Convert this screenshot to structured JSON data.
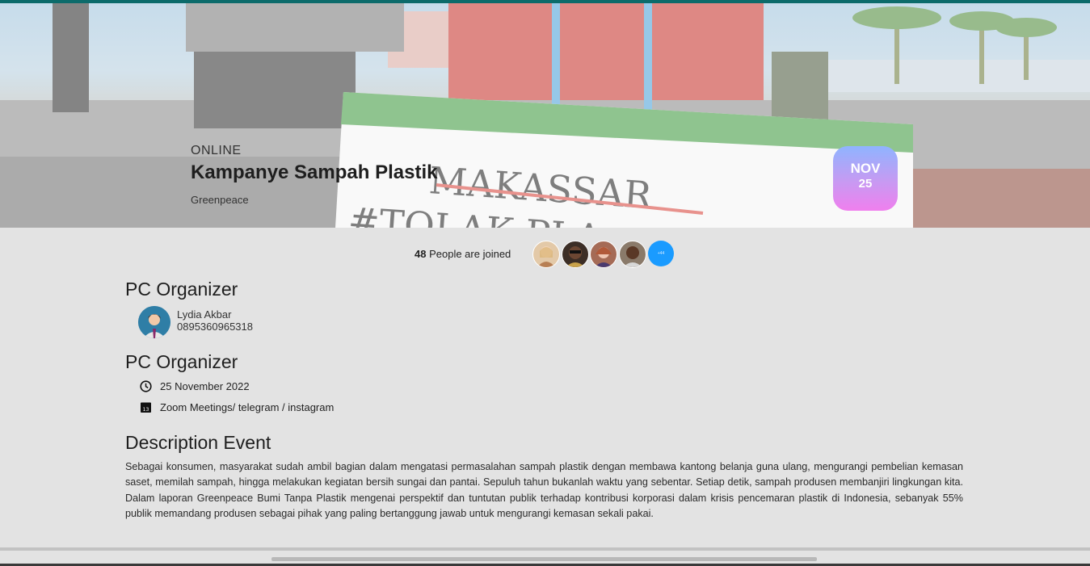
{
  "hero": {
    "status": "ONLINE",
    "title": "Kampanye Sampah Plastik",
    "organization": "Greenpeace",
    "date_month": "NOV",
    "date_day": "25",
    "poster_line1": "MAKASSAR",
    "poster_line2": "#TOLAK PLA"
  },
  "joined": {
    "count": "48",
    "label": "People are joined",
    "more_label": "+44"
  },
  "organizer": {
    "heading": "PC Organizer",
    "name": "Lydia Akbar",
    "phone": "0895360965318"
  },
  "details": {
    "heading": "PC Organizer",
    "date": "25 November 2022",
    "calendar_day": "13",
    "location": "Zoom Meetings/ telegram / instagram"
  },
  "description": {
    "heading": "Description Event",
    "body": "Sebagai konsumen, masyarakat sudah ambil bagian dalam mengatasi permasalahan sampah plastik dengan membawa kantong belanja guna ulang, mengurangi pembelian kemasan saset, memilah sampah, hingga melakukan kegiatan bersih sungai dan pantai. Sepuluh tahun bukanlah waktu yang sebentar. Setiap detik, sampah produsen membanjiri lingkungan kita. Dalam laporan Greenpeace Bumi Tanpa Plastik mengenai perspektif dan tuntutan publik terhadap kontribusi korporasi dalam krisis pencemaran plastik di Indonesia, sebanyak 55% publik memandang produsen sebagai pihak yang paling bertanggung jawab untuk mengurangi kemasan sekali pakai."
  },
  "icons": {
    "clock": "clock-icon",
    "calendar": "calendar-icon"
  },
  "colors": {
    "badge_gradient_top": "#8fb4ff",
    "badge_gradient_bottom": "#f07fee",
    "more_avatar": "#1a9bff",
    "top_bar": "#0c6b6b"
  }
}
